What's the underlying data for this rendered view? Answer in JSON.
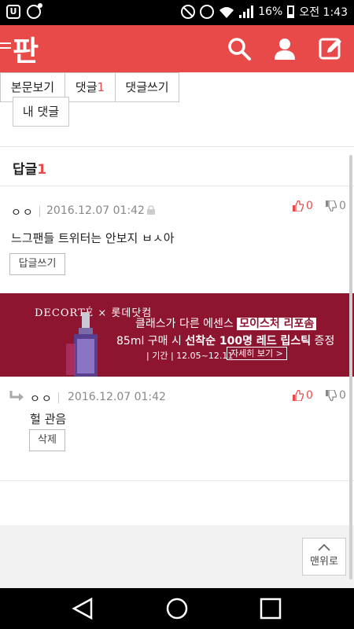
{
  "status_bar": {
    "battery": "16%",
    "time": "오전 1:43"
  },
  "app_bar": {
    "logo": "판",
    "icons": [
      "menu-icon",
      "search-icon",
      "user-icon",
      "edit-icon"
    ]
  },
  "tabs": {
    "my_comments": "내 댓글",
    "view_post": "본문보기",
    "comments_label": "댓글",
    "comments_count": "1",
    "write_comment": "댓글쓰기"
  },
  "reply_header": {
    "label": "답글",
    "count": "1"
  },
  "comments": [
    {
      "author": "ㅇㅇ",
      "date": "2016.12.07 01:42",
      "text": "느그팬들 트위터는 안보지 ㅂㅅ아",
      "action": "답글쓰기",
      "up": "0",
      "down": "0"
    },
    {
      "author": "ㅇㅇ",
      "date": "2016.12.07 01:42",
      "text": "헐 관음",
      "action": "삭제",
      "up": "0",
      "down": "0"
    }
  ],
  "ad": {
    "brand": "DECORTÉ × 롯데닷컴",
    "line1_prefix": "클래스가 다른 에센스 ",
    "line1_highlight": "모이스처 리포솜",
    "line2_prefix": "85ml 구매 시 ",
    "line2_bold": "선착순 100명 레드 립스틱",
    "line2_suffix": " 증정",
    "line3": "| 기간 | 12.05~12.11",
    "details_button": "자세히 보기 >",
    "colors": {
      "background": "#8e1530"
    }
  },
  "scroll_top": {
    "label": "맨위로"
  },
  "colors": {
    "accent": "#e84a4a"
  }
}
